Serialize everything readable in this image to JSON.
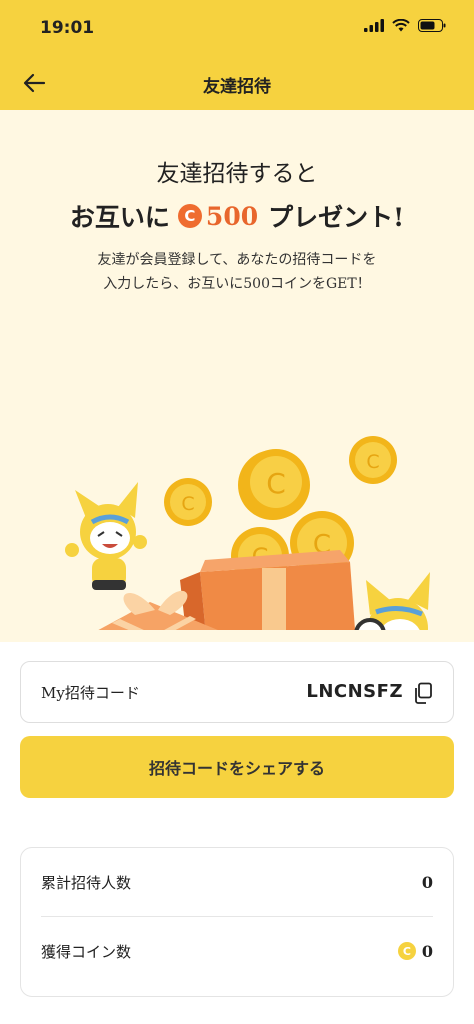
{
  "status_bar": {
    "time": "19:01"
  },
  "header": {
    "title": "友達招待"
  },
  "hero": {
    "line1": "友達招待すると",
    "line2_pre": "お互いに",
    "coin_symbol": "C",
    "amount": "500",
    "line2_post": "プレゼント!",
    "desc_line1": "友達が会員登録して、あなたの招待コードを",
    "desc_line2": "入力したら、お互いに500コインをGET！"
  },
  "invite": {
    "label": "My招待コード",
    "code": "LNCNSFZ"
  },
  "share_button": {
    "label": "招待コードをシェアする"
  },
  "stats": {
    "invites_label": "累計招待人数",
    "invites_value": "0",
    "coins_label": "獲得コイン数",
    "coin_symbol": "C",
    "coins_value": "0"
  },
  "colors": {
    "accent": "#f6d23f",
    "hero_bg": "#fff8e2",
    "coin_orange": "#ef6c2f"
  }
}
